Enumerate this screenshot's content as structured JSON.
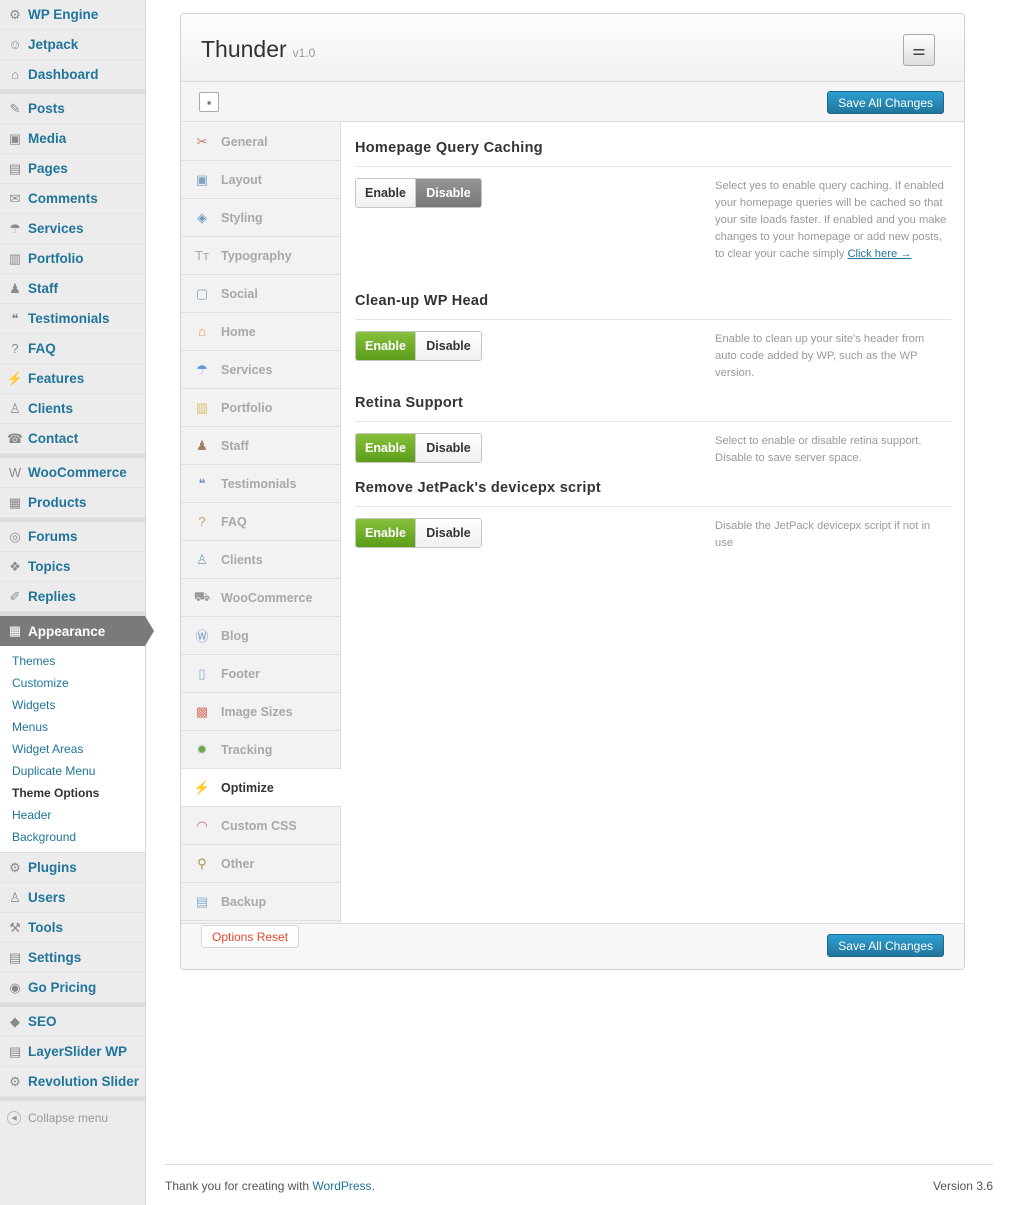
{
  "sidebar": {
    "groups": [
      [
        {
          "label": "WP Engine",
          "icon": "⚙"
        },
        {
          "label": "Jetpack",
          "icon": "☺"
        },
        {
          "label": "Dashboard",
          "icon": "⌂"
        }
      ],
      [
        {
          "label": "Posts",
          "icon": "✎"
        },
        {
          "label": "Media",
          "icon": "▣"
        },
        {
          "label": "Pages",
          "icon": "▤"
        },
        {
          "label": "Comments",
          "icon": "✉"
        },
        {
          "label": "Services",
          "icon": "☂"
        },
        {
          "label": "Portfolio",
          "icon": "▥"
        },
        {
          "label": "Staff",
          "icon": "♟"
        },
        {
          "label": "Testimonials",
          "icon": "❝"
        },
        {
          "label": "FAQ",
          "icon": "?"
        },
        {
          "label": "Features",
          "icon": "⚡"
        },
        {
          "label": "Clients",
          "icon": "♙"
        },
        {
          "label": "Contact",
          "icon": "☎"
        }
      ],
      [
        {
          "label": "WooCommerce",
          "icon": "W"
        },
        {
          "label": "Products",
          "icon": "▦"
        }
      ],
      [
        {
          "label": "Forums",
          "icon": "◎"
        },
        {
          "label": "Topics",
          "icon": "❖"
        },
        {
          "label": "Replies",
          "icon": "✐"
        }
      ]
    ],
    "appearance": {
      "label": "Appearance",
      "icon": "▦"
    },
    "appearance_submenu": [
      "Themes",
      "Customize",
      "Widgets",
      "Menus",
      "Widget Areas",
      "Duplicate Menu",
      "Theme Options",
      "Header",
      "Background"
    ],
    "active_submenu": "Theme Options",
    "groups_after": [
      [
        {
          "label": "Plugins",
          "icon": "⚙"
        },
        {
          "label": "Users",
          "icon": "♙"
        },
        {
          "label": "Tools",
          "icon": "⚒"
        },
        {
          "label": "Settings",
          "icon": "▤"
        },
        {
          "label": "Go Pricing",
          "icon": "◉"
        }
      ],
      [
        {
          "label": "SEO",
          "icon": "◆"
        },
        {
          "label": "LayerSlider WP",
          "icon": "▤"
        },
        {
          "label": "Revolution Slider",
          "icon": "⚙"
        }
      ]
    ],
    "collapse_label": "Collapse menu"
  },
  "panel": {
    "title": "Thunder",
    "version": "v1.0",
    "save_label": "Save All Changes",
    "reset_label": "Options Reset"
  },
  "tabs": [
    {
      "label": "General",
      "icon": "✂",
      "color": "#c77c5b"
    },
    {
      "label": "Layout",
      "icon": "▣",
      "color": "#7ea4c8"
    },
    {
      "label": "Styling",
      "icon": "◈",
      "color": "#6c99c6"
    },
    {
      "label": "Typography",
      "icon": "Tт",
      "color": "#aaaaaa"
    },
    {
      "label": "Social",
      "icon": "▢",
      "color": "#7ea4c8"
    },
    {
      "label": "Home",
      "icon": "⌂",
      "color": "#e09a5a"
    },
    {
      "label": "Services",
      "icon": "☂",
      "color": "#5d9ad6"
    },
    {
      "label": "Portfolio",
      "icon": "▥",
      "color": "#d9c06a"
    },
    {
      "label": "Staff",
      "icon": "♟",
      "color": "#a08060"
    },
    {
      "label": "Testimonials",
      "icon": "❝",
      "color": "#6c99c6"
    },
    {
      "label": "FAQ",
      "icon": "?",
      "color": "#e09a5a"
    },
    {
      "label": "Clients",
      "icon": "♙",
      "color": "#7ea4c8"
    },
    {
      "label": "WooCommerce",
      "icon": "⛟",
      "color": "#999999"
    },
    {
      "label": "Blog",
      "icon": "Ⓦ",
      "color": "#6c99c6"
    },
    {
      "label": "Footer",
      "icon": "▯",
      "color": "#8ab0d0"
    },
    {
      "label": "Image Sizes",
      "icon": "▩",
      "color": "#d97a6a"
    },
    {
      "label": "Tracking",
      "icon": "✹",
      "color": "#6aa84f"
    },
    {
      "label": "Optimize",
      "icon": "⚡",
      "color": "#333333"
    },
    {
      "label": "Custom CSS",
      "icon": "◠",
      "color": "#e06060"
    },
    {
      "label": "Other",
      "icon": "⚲",
      "color": "#b08a50"
    },
    {
      "label": "Backup",
      "icon": "▤",
      "color": "#8ab0d0"
    }
  ],
  "active_tab": "Optimize",
  "options": [
    {
      "title": "Homepage Query Caching",
      "enable_label": "Enable",
      "disable_label": "Disable",
      "state": "disable",
      "description": "Select yes to enable query caching. If enabled your homepage queries will be cached so that your site loads faster. If enabled and you make changes to your homepage or add new posts, to clear your cache simply",
      "link_text": "Click here →"
    },
    {
      "title": "Clean-up WP Head",
      "enable_label": "Enable",
      "disable_label": "Disable",
      "state": "enable",
      "description": "Enable to clean up your site's header from auto code added by WP, such as the WP version."
    },
    {
      "title": "Retina Support",
      "enable_label": "Enable",
      "disable_label": "Disable",
      "state": "enable",
      "description": "Select to enable or disable retina support. Disable to save server space."
    },
    {
      "title": "Remove JetPack's devicepx script",
      "enable_label": "Enable",
      "disable_label": "Disable",
      "state": "enable",
      "description": "Disable the JetPack devicepx script if not in use"
    }
  ],
  "footer": {
    "thanks_prefix": "Thank you for creating with",
    "wp_link": "WordPress",
    "thanks_suffix": ".",
    "version": "Version 3.6"
  }
}
